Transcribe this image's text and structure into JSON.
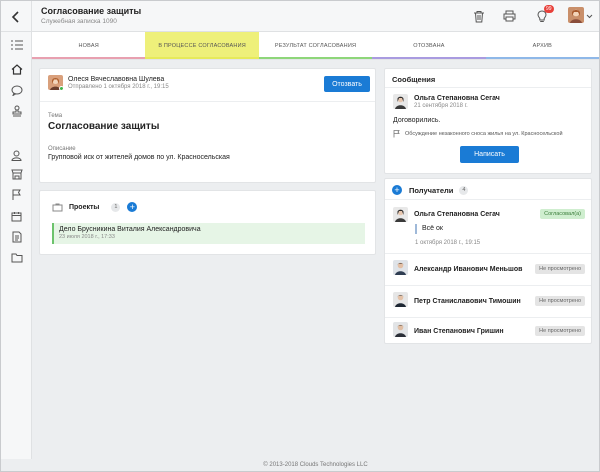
{
  "header": {
    "title": "Согласование защиты",
    "subtitle": "Служебная записка 1090",
    "notification_count": "99",
    "icons": [
      "back-icon",
      "trash-icon",
      "printer-icon",
      "lightbulb-icon",
      "chevron-down-icon"
    ]
  },
  "tabs": [
    {
      "label": "НОВАЯ",
      "color": "#e8a0b0"
    },
    {
      "label": "В ПРОЦЕССЕ СОГЛАСОВАНИЯ",
      "color": "#e6ea5a"
    },
    {
      "label": "РЕЗУЛЬТАТ СОГЛАСОВАНИЯ",
      "color": "#8ed67a"
    },
    {
      "label": "ОТОЗВАНА",
      "color": "#a99be0"
    },
    {
      "label": "АРХИВ",
      "color": "#8fb8e8"
    }
  ],
  "main": {
    "author_name": "Олеся Вячеславовна Шулева",
    "author_date": "Отправлено 1 октября 2018 г., 19:15",
    "recall_button": "Отозвать",
    "theme_label": "Тема",
    "theme_value": "Согласование защиты",
    "description_label": "Описание",
    "description_value": "Групповой иск от жителей домов по ул. Красносельская"
  },
  "projects": {
    "title": "Проекты",
    "count": "1",
    "item_title": "Дело Брусникина Виталия Александровича",
    "item_date": "23 июля 2018 г., 17:33"
  },
  "messages": {
    "title": "Сообщения",
    "author": "Ольга Степановна Сегач",
    "date": "21 сентября 2018 г.",
    "text": "Договорились.",
    "reference": "Обсуждение незаконного сноса жилья на ул. Красносельской",
    "write_button": "Написать"
  },
  "recipients": {
    "title": "Получатели",
    "count": "4",
    "items": [
      {
        "name": "Ольга Степановна Сегач",
        "status": "Согласовал(а)",
        "comment": "Всё ок",
        "date": "1 октября 2018 г., 19:15"
      },
      {
        "name": "Александр Иванович Меньшов",
        "status": "Не просмотрено"
      },
      {
        "name": "Петр Станиславович Тимошин",
        "status": "Не просмотрено"
      },
      {
        "name": "Иван Степанович Гришин",
        "status": "Не просмотрено"
      }
    ]
  },
  "footer": {
    "copyright": "© 2013-2018 Clouds Technologies LLC"
  },
  "colors": {
    "accent": "#1a7bd5",
    "active_tab": "#eef07a",
    "approved": "#cfeecf",
    "badge": "#e8403a"
  }
}
